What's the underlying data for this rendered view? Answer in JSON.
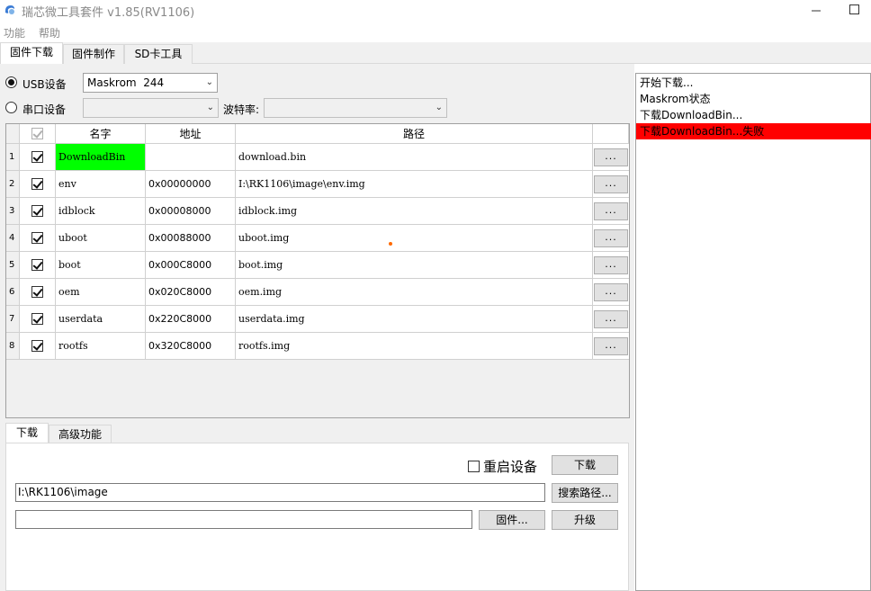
{
  "window": {
    "title": "瑞芯微工具套件 v1.85(RV1106)",
    "minimize_label": "—",
    "maximize_label": "☐"
  },
  "menu": [
    "功能",
    "帮助"
  ],
  "top_tabs": [
    {
      "label": "固件下载",
      "active": true
    },
    {
      "label": "固件制作",
      "active": false
    },
    {
      "label": "SD卡工具",
      "active": false
    }
  ],
  "device": {
    "usb_label": "USB设备",
    "usb_selected": true,
    "usb_value": "Maskrom  244",
    "serial_label": "串口设备",
    "serial_selected": false,
    "serial_value": "",
    "baud_label": "波特率:",
    "baud_value": ""
  },
  "grid": {
    "headers": {
      "name": "名字",
      "address": "地址",
      "path": "路径"
    },
    "button_label": "...",
    "rows": [
      {
        "num": "1",
        "checked": true,
        "name": "DownloadBin",
        "address": "",
        "path": "download.bin",
        "highlight": "#00ff00"
      },
      {
        "num": "2",
        "checked": true,
        "name": "env",
        "address": "0x00000000",
        "path": "I:\\RK1106\\image\\env.img"
      },
      {
        "num": "3",
        "checked": true,
        "name": "idblock",
        "address": "0x00008000",
        "path": "idblock.img"
      },
      {
        "num": "4",
        "checked": true,
        "name": "uboot",
        "address": "0x00088000",
        "path": "uboot.img"
      },
      {
        "num": "5",
        "checked": true,
        "name": "boot",
        "address": "0x000C8000",
        "path": "boot.img"
      },
      {
        "num": "6",
        "checked": true,
        "name": "oem",
        "address": "0x020C8000",
        "path": "oem.img"
      },
      {
        "num": "7",
        "checked": true,
        "name": "userdata",
        "address": "0x220C8000",
        "path": "userdata.img"
      },
      {
        "num": "8",
        "checked": true,
        "name": "rootfs",
        "address": "0x320C8000",
        "path": "rootfs.img"
      }
    ]
  },
  "bottom_tabs": [
    {
      "label": "下载",
      "active": true
    },
    {
      "label": "高级功能",
      "active": false
    }
  ],
  "download_panel": {
    "reboot_label": "重启设备",
    "reboot_checked": false,
    "download_button": "下载",
    "path_value": "I:\\RK1106\\image",
    "search_path_button": "搜索路径...",
    "firmware_value": "",
    "firmware_button": "固件...",
    "upgrade_button": "升级"
  },
  "log": [
    {
      "text": "开始下载...",
      "error": false
    },
    {
      "text": "Maskrom状态",
      "error": false
    },
    {
      "text": "下载DownloadBin...",
      "error": false
    },
    {
      "text": "下载DownloadBin...失败",
      "error": true
    }
  ],
  "colors": {
    "success_highlight": "#00ff00",
    "error_highlight": "#ff0000"
  }
}
